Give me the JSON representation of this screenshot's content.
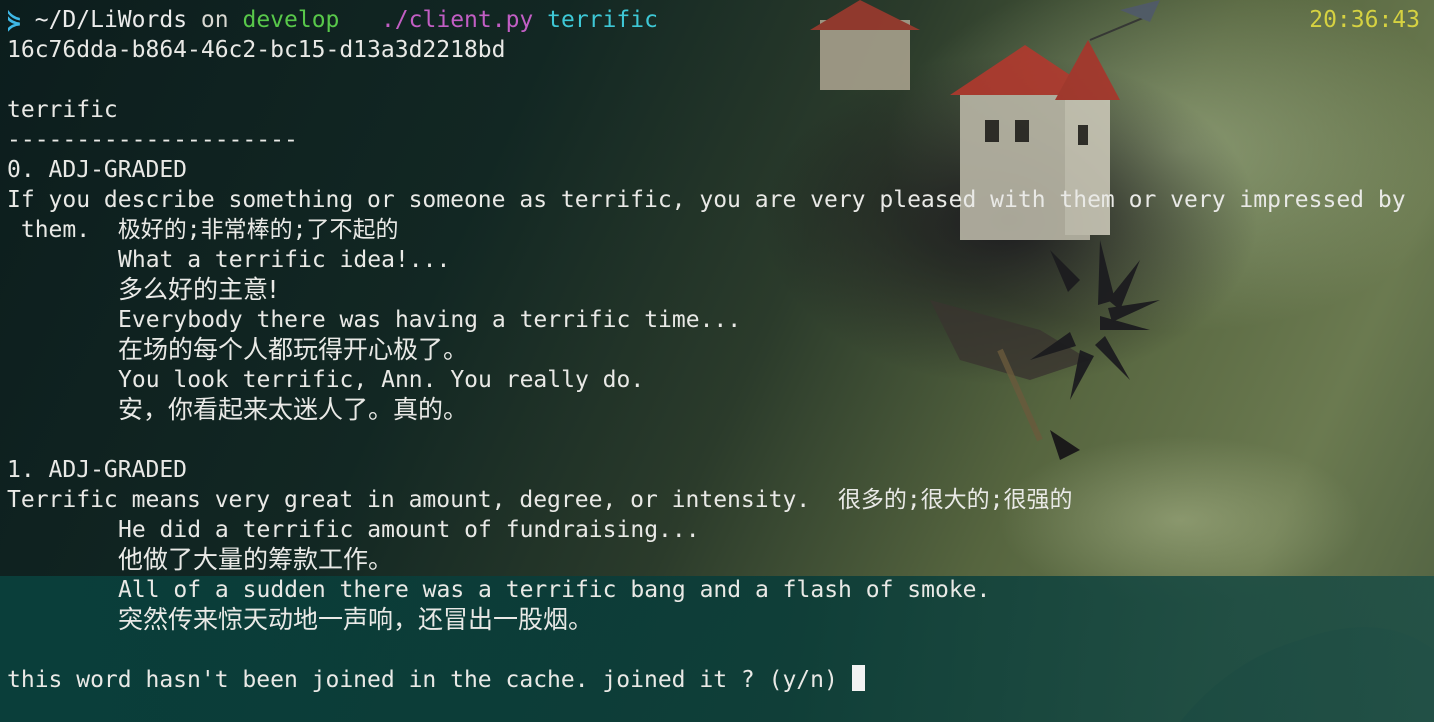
{
  "prompt": {
    "arrow_glyph": "⋟",
    "path": "~/D/LiWords",
    "on": "on",
    "branch": "develop",
    "command": "./client.py",
    "argument": "terrific",
    "clock": "20:36:43"
  },
  "session_id": "16c76dda-b864-46c2-bc15-d13a3d2218bd",
  "word": "terrific",
  "separator": "---------------------",
  "senses": [
    {
      "heading": "0. ADJ-GRADED",
      "definition_line1": "If you describe something or someone as terrific, you are very pleased with them or very impressed by",
      "definition_line2": " them.  极好的;非常棒的;了不起的",
      "examples": [
        {
          "en": "What a terrific idea!...",
          "zh": "多么好的主意!"
        },
        {
          "en": "Everybody there was having a terrific time...",
          "zh": "在场的每个人都玩得开心极了。"
        },
        {
          "en": "You look terrific, Ann. You really do.",
          "zh": "安，你看起来太迷人了。真的。"
        }
      ]
    },
    {
      "heading": "1. ADJ-GRADED",
      "definition_line1": "Terrific means very great in amount, degree, or intensity.  很多的;很大的;很强的",
      "examples": [
        {
          "en": "He did a terrific amount of fundraising...",
          "zh": "他做了大量的筹款工作。"
        },
        {
          "en": "All of a sudden there was a terrific bang and a flash of smoke.",
          "zh": "突然传来惊天动地一声响，还冒出一股烟。"
        }
      ]
    }
  ],
  "input_prompt": "this word hasn't been joined in the cache. joined it ? (y/n)",
  "colors": {
    "prompt_arrow": "#3eb8e6",
    "branch": "#58c84a",
    "command": "#c25ec4",
    "argument": "#3ec8d6",
    "clock": "#d6d241",
    "text": "#e9e9e6",
    "highlight_band": "#0a403c"
  }
}
